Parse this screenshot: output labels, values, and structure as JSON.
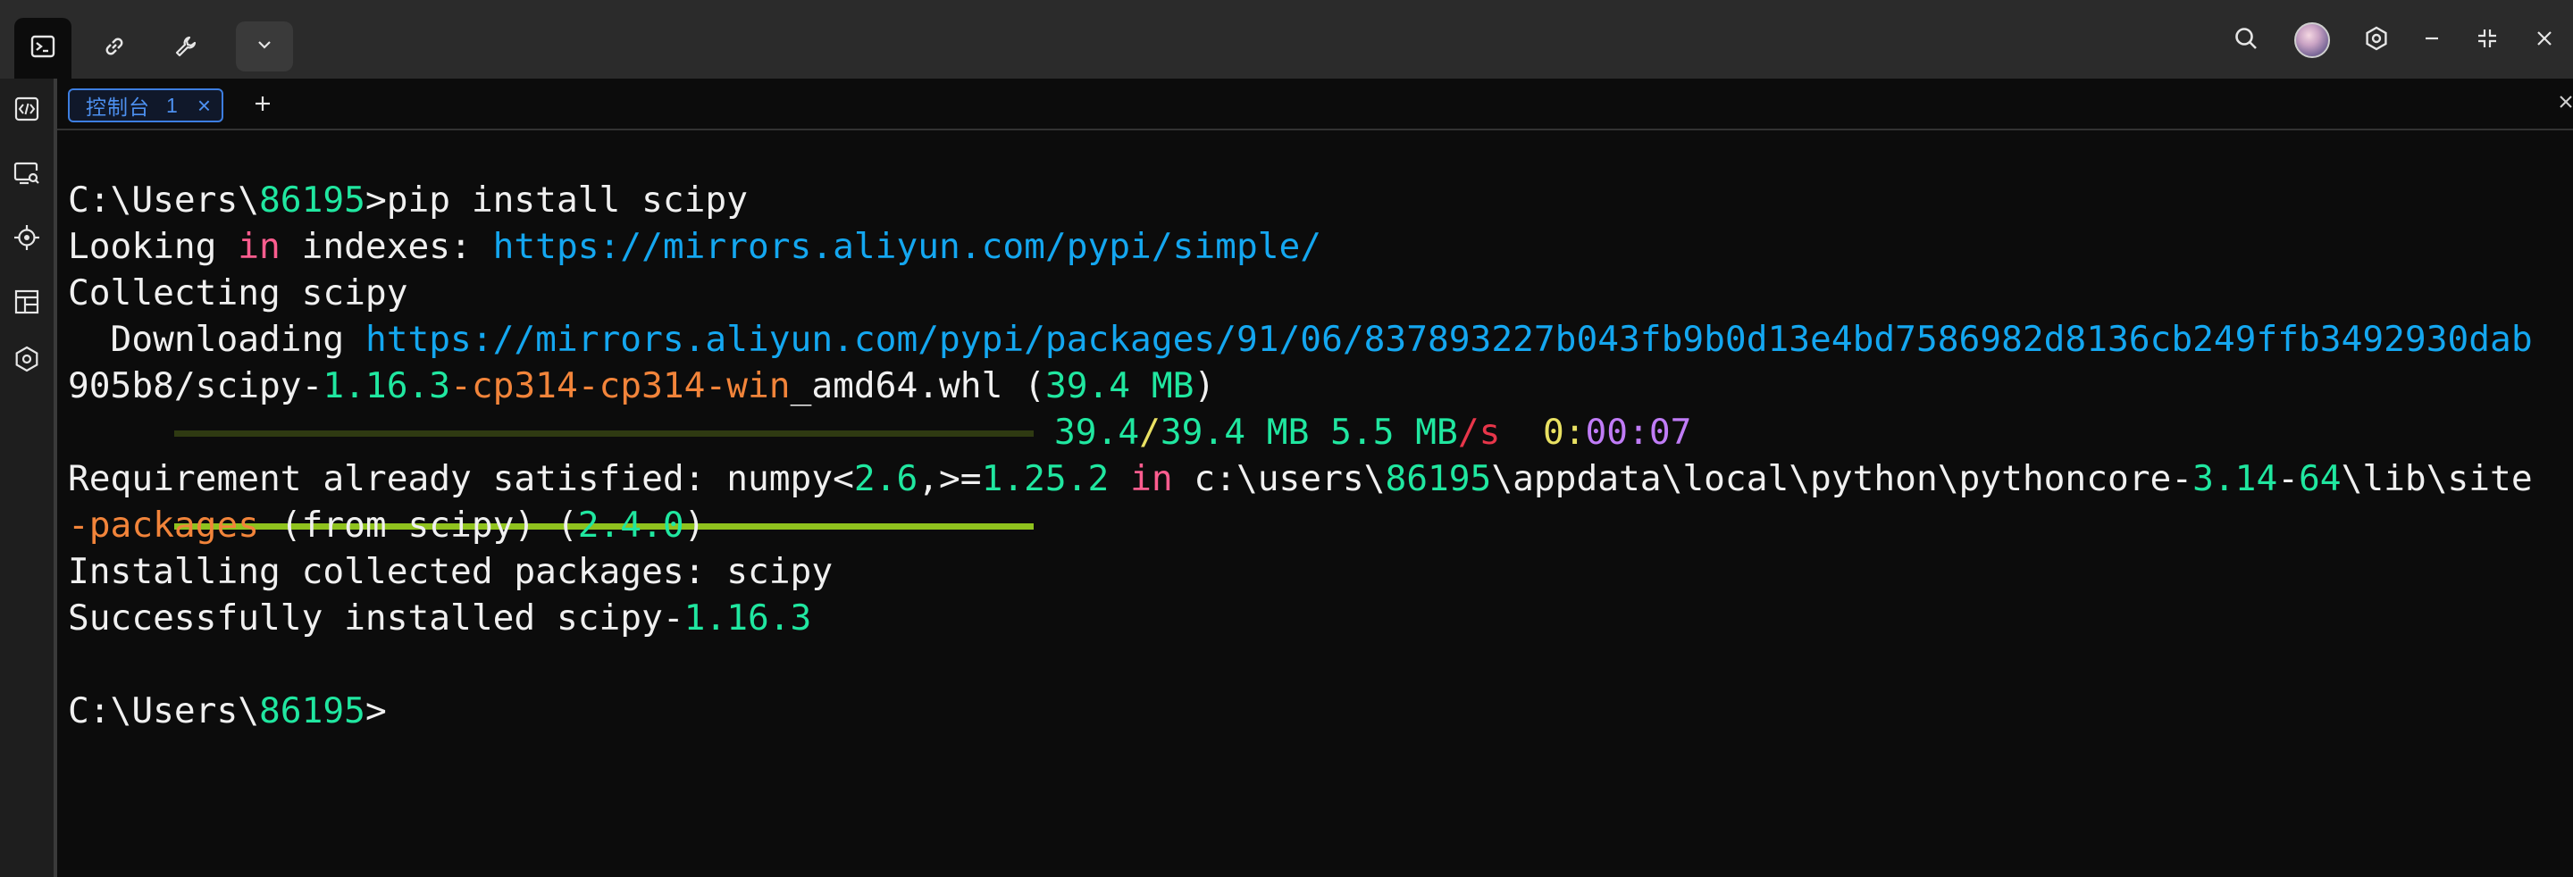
{
  "titlebar": {
    "tabs": [
      {
        "icon": "terminal-icon"
      },
      {
        "icon": "link-icon"
      },
      {
        "icon": "wrench-icon"
      },
      {
        "icon": "chevron-down-icon"
      }
    ],
    "right_icons": [
      "search-icon",
      "avatar",
      "settings-icon",
      "minimize-icon",
      "restore-icon",
      "close-icon"
    ]
  },
  "sidebar": {
    "icons": [
      "code-icon",
      "search-screen-icon",
      "target-icon",
      "layout-icon",
      "hexagon-icon"
    ]
  },
  "tabstrip": {
    "tab_title": "控制台",
    "tab_number": "1",
    "tab_close": "×",
    "new_tab": "+",
    "close_panel": "×"
  },
  "terminal": {
    "line1": {
      "a": "C:\\Users\\",
      "b": "86195",
      "c": ">pip install scipy"
    },
    "line2": {
      "a": "Looking ",
      "b": "in",
      "c": " indexes: ",
      "d": "https://mirrors.aliyun.com/pypi/simple/"
    },
    "line3": {
      "a": "Collecting scipy"
    },
    "line4": {
      "a": "  Downloading ",
      "b": "https://mirrors.aliyun.com/pypi/packages/91/06/837893227b043fb9b0d13e4bd7586982d8136cb249ffb3492930dab"
    },
    "line5": {
      "a": "905b8/scipy-",
      "b": "1.16.3",
      "c": "-cp314-cp314-win",
      "d": "_amd64.whl (",
      "e": "39.4 MB",
      "f": ")"
    },
    "line6": {
      "progress": 1.0,
      "a": "39.4",
      "b": "/",
      "c": "39.4 MB",
      "d": " ",
      "e": "5.5 MB",
      "f": "/s",
      "g": "  ",
      "h": "0",
      "i": ":",
      "j": "00",
      "k": ":",
      "l": "07"
    },
    "line7": {
      "a": "Requirement already satisfied: numpy<",
      "b": "2.6",
      "c": ",>=",
      "d": "1.25.2",
      "e": " ",
      "f": "in",
      "g": " c:\\users\\",
      "h": "86195",
      "i": "\\appdata\\local\\python\\pythoncore-",
      "j": "3.14",
      "k": "-",
      "l": "64",
      "m": "\\lib\\site"
    },
    "line8": {
      "a": "-packages",
      "b": " (from scipy) (",
      "c": "2.4.0",
      "d": ")"
    },
    "line9": {
      "a": "Installing collected packages: scipy"
    },
    "line10": {
      "a": "Successfully installed scipy-",
      "b": "1.16.3"
    },
    "line11": {
      "a": ""
    },
    "line12": {
      "a": "C:\\Users\\",
      "b": "86195",
      "c": ">"
    }
  },
  "colors": {
    "background": "#0c0c0c",
    "number": "#20e7a0",
    "keyword": "#ff5d8f",
    "url": "#14a7f0",
    "accent_orange": "#f2843a",
    "rate_red": "#e8364a",
    "time_purple": "#c07cf7",
    "progress_green": "#8fc21e",
    "tab_blue": "#3d7ee0"
  }
}
